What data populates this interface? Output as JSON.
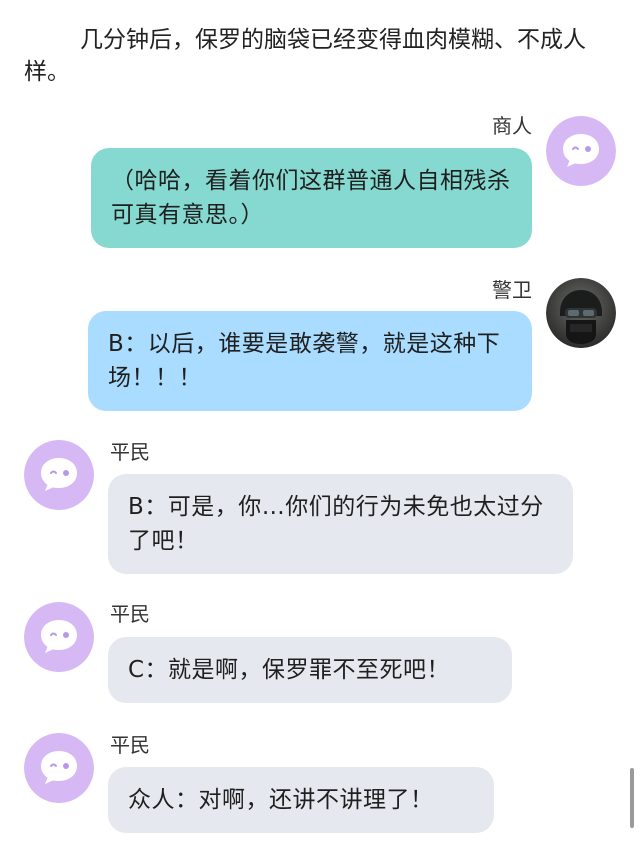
{
  "colors": {
    "green_bubble": "#86d9d0",
    "blue_bubble": "#a9dcff",
    "gray_bubble": "#e6e8ef",
    "avatar_purple": "#d6b8f5"
  },
  "narration": "几分钟后，保罗的脑袋已经变得血肉模糊、不成人样。",
  "messages": [
    {
      "speaker": "商人",
      "side": "right",
      "color": "green",
      "avatar": "purple-chat-face-icon",
      "text": "（哈哈，看着你们这群普通人自相残杀可真有意思。）"
    },
    {
      "speaker": "警卫",
      "side": "right",
      "color": "blue",
      "avatar": "helmeted-guard-photo",
      "text": "B：以后，谁要是敢袭警，就是这种下场！！！"
    },
    {
      "speaker": "平民",
      "side": "left",
      "color": "gray",
      "avatar": "purple-chat-face-icon",
      "text": "B：可是，你…你们的行为未免也太过分了吧！"
    },
    {
      "speaker": "平民",
      "side": "left",
      "color": "gray",
      "avatar": "purple-chat-face-icon",
      "text": "C：就是啊，保罗罪不至死吧！"
    },
    {
      "speaker": "平民",
      "side": "left",
      "color": "gray",
      "avatar": "purple-chat-face-icon",
      "text": "众人：对啊，还讲不讲理了！"
    }
  ]
}
